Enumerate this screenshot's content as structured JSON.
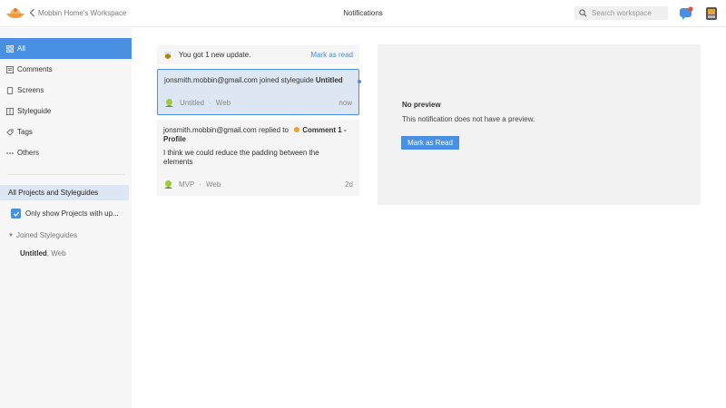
{
  "header": {
    "back_label": "Mobbin Home's Workspace",
    "title": "Notifications",
    "search_placeholder": "Search workspace",
    "logo": "mobbin-logo",
    "icons": [
      "chat-icon",
      "device-icon"
    ]
  },
  "sidebar": {
    "items": [
      {
        "label": "All",
        "icon": "all-icon",
        "active": true
      },
      {
        "label": "Comments",
        "icon": "comment-icon",
        "active": false
      },
      {
        "label": "Screens",
        "icon": "screens-icon",
        "active": false
      },
      {
        "label": "Styleguide",
        "icon": "styleguide-icon",
        "active": false
      },
      {
        "label": "Tags",
        "icon": "tag-icon",
        "active": false
      },
      {
        "label": "Others",
        "icon": "more-icon",
        "active": false
      }
    ],
    "filter_label": "All Projects and Styleguides",
    "only_show_label": "Only show Projects with up...",
    "only_show_checked": true,
    "joined_header": "Joined Styleguides",
    "joined_items": [
      {
        "name": "Untitled",
        "platform": ", Web"
      }
    ]
  },
  "update_bar": {
    "text": "You got 1 new update.",
    "mark_as_read": "Mark as read"
  },
  "notifications": [
    {
      "user": "jonsmith.mobbin@gmail.com",
      "action": " joined styleguide ",
      "target": "Untitled",
      "project": "Untitled",
      "platform": "Web",
      "time": "now",
      "selected": true,
      "unread": true
    },
    {
      "user": "jonsmith.mobbin@gmail.com",
      "action": " replied to ",
      "target": "Comment 1 - Profile",
      "comment": "I think we could reduce the padding between the elements",
      "project": "MVP",
      "platform": "Web",
      "time": "2d",
      "selected": false,
      "unread": false
    }
  ],
  "preview": {
    "title": "No preview",
    "description": "This notification does not have a preview.",
    "button": "Mark as Read"
  },
  "colors": {
    "accent": "#4a90e2",
    "selected_bg": "#dde7f4",
    "comment_dot": "#f0a030"
  }
}
